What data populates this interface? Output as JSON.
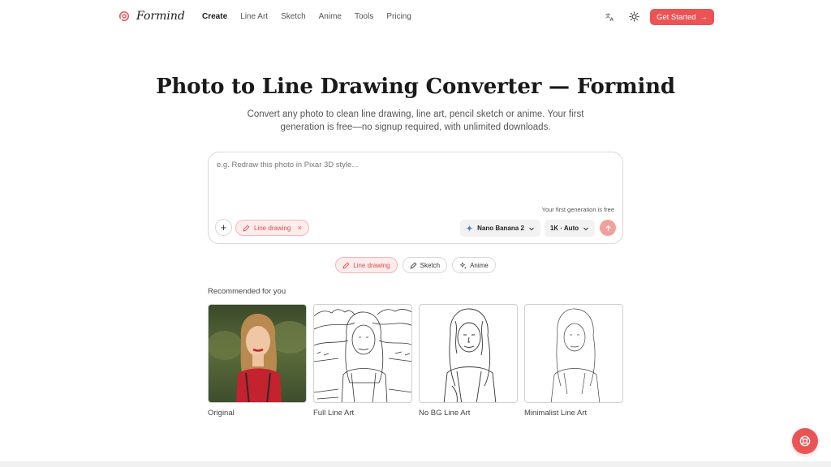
{
  "header": {
    "logo_text": "Formind",
    "nav": [
      {
        "label": "Create",
        "active": true
      },
      {
        "label": "Line Art",
        "active": false
      },
      {
        "label": "Sketch",
        "active": false
      },
      {
        "label": "Anime",
        "active": false
      },
      {
        "label": "Tools",
        "active": false
      },
      {
        "label": "Pricing",
        "active": false
      }
    ],
    "translate_icon": "translate-icon",
    "theme_icon": "sun-icon",
    "cta_label": "Get Started"
  },
  "hero": {
    "title": "Photo to Line Drawing Converter — Formind",
    "subtitle": "Convert any photo to clean line drawing, line art, pencil sketch or anime. Your first generation is free—no signup required, with unlimited downloads."
  },
  "prompt": {
    "placeholder": "e.g. Redraw this photo in Pixar 3D style...",
    "free_note": "Your first generation is free",
    "chip_label": "Line drawing",
    "model_label": "Nano Banana 2",
    "resolution_label": "1K · Auto"
  },
  "styles": [
    {
      "label": "Line drawing",
      "active": true
    },
    {
      "label": "Sketch",
      "active": false
    },
    {
      "label": "Anime",
      "active": false
    }
  ],
  "recommended": {
    "title": "Recommended for you",
    "items": [
      {
        "caption": "Original"
      },
      {
        "caption": "Full Line Art"
      },
      {
        "caption": "No BG Line Art"
      },
      {
        "caption": "Minimalist Line Art"
      }
    ]
  },
  "colors": {
    "accent": "#ea5455",
    "accent_soft": "#fdecec",
    "send_disabled": "#f2a09b"
  }
}
